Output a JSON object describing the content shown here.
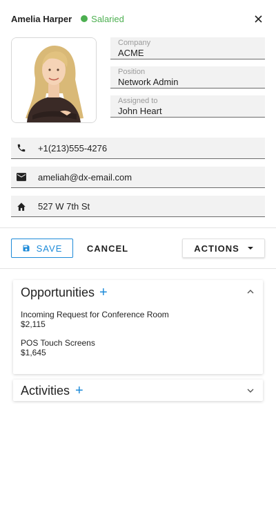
{
  "header": {
    "name": "Amelia Harper",
    "status": "Salaried",
    "status_color": "#4caf50"
  },
  "photo": {
    "icon": "person-photo"
  },
  "info": {
    "company": {
      "label": "Company",
      "value": "ACME"
    },
    "position": {
      "label": "Position",
      "value": "Network Admin"
    },
    "assigned": {
      "label": "Assigned to",
      "value": "John Heart"
    }
  },
  "contacts": {
    "phone": {
      "icon": "phone-icon",
      "value": "+1(213)555-4276"
    },
    "email": {
      "icon": "email-icon",
      "value": "ameliah@dx-email.com"
    },
    "address": {
      "icon": "home-icon",
      "value": "527 W 7th St"
    }
  },
  "toolbar": {
    "save_label": "SAVE",
    "cancel_label": "CANCEL",
    "actions_label": "ACTIONS"
  },
  "opportunities": {
    "title": "Opportunities",
    "items": [
      {
        "name": "Incoming Request for Conference Room",
        "amount": "$2,115"
      },
      {
        "name": "POS Touch Screens",
        "amount": "$1,645"
      }
    ]
  },
  "activities": {
    "title": "Activities"
  },
  "colors": {
    "accent": "#1c8ad8",
    "field_bg": "#f2f2f2"
  }
}
